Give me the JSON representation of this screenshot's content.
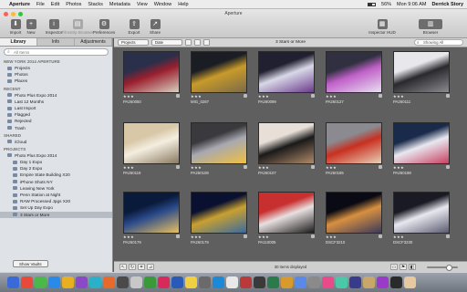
{
  "menubar": {
    "apple": "",
    "app": "Aperture",
    "items": [
      "File",
      "Edit",
      "Photos",
      "Stacks",
      "Metadata",
      "View",
      "Window",
      "Help"
    ],
    "battery": "56%",
    "time": "Mon 9:06 AM",
    "user": "Derrick Story"
  },
  "window": {
    "title": "Aperture"
  },
  "toolbar": {
    "import": "Import",
    "new": "New",
    "inspector": "Inspector",
    "filmstrip": "Filmstrip Browser",
    "preferences": "Preferences",
    "export": "Export",
    "share": "Share",
    "inspector_hud": "Inspector HUD",
    "browser": "Browser"
  },
  "sidebar": {
    "tabs": [
      "Library",
      "Info",
      "Adjustments"
    ],
    "search_placeholder": "All Items",
    "sections": [
      {
        "title": "NEW YORK 2014 APERTURE",
        "items": [
          {
            "label": "Projects",
            "count": ""
          },
          {
            "label": "Photos",
            "count": ""
          },
          {
            "label": "Places",
            "count": ""
          }
        ]
      },
      {
        "title": "RECENT",
        "items": [
          {
            "label": "Photo Plus Expo 2014",
            "count": ""
          },
          {
            "label": "Last 12 Months",
            "count": ""
          },
          {
            "label": "Last Import",
            "count": ""
          },
          {
            "label": "Flagged",
            "count": ""
          },
          {
            "label": "Rejected",
            "count": ""
          },
          {
            "label": "Trash",
            "count": ""
          }
        ]
      },
      {
        "title": "SHARED",
        "items": [
          {
            "label": "iCloud",
            "count": ""
          }
        ]
      },
      {
        "title": "PROJECTS",
        "items": [
          {
            "label": "Photo Plus Expo 2014",
            "count": "",
            "level": 0
          },
          {
            "label": "Day 1 Expo",
            "count": "",
            "level": 1
          },
          {
            "label": "Day 2 Expo",
            "count": "",
            "level": 1
          },
          {
            "label": "Empire State Building X20",
            "count": "",
            "level": 1
          },
          {
            "label": "iPhone Shots NY",
            "count": "",
            "level": 1
          },
          {
            "label": "Leaving New York",
            "count": "",
            "level": 1
          },
          {
            "label": "Penn Station at Night",
            "count": "",
            "level": 1
          },
          {
            "label": "RAW Processed Jpgs X20",
            "count": "",
            "level": 1
          },
          {
            "label": "Set Up Day Expo",
            "count": "",
            "level": 1
          },
          {
            "label": "3 Stars or More",
            "count": "",
            "level": 1,
            "selected": true
          }
        ]
      }
    ],
    "show_vaults": "Show Vaults"
  },
  "filterbar": {
    "mode": "Projects",
    "sort": "Date",
    "album_title": "3 Stars or More",
    "search_placeholder": "Showing All"
  },
  "photos": [
    {
      "caption": "PA260050",
      "stars": "★★★",
      "colors": [
        "#2a2f4a",
        "#9a1f2e",
        "#d8d0c0"
      ]
    },
    {
      "caption": "MIG_0287",
      "stars": "★★★",
      "colors": [
        "#1a1e24",
        "#c89a2a",
        "#7a6a48"
      ]
    },
    {
      "caption": "PA260099",
      "stars": "★★★",
      "colors": [
        "#202030",
        "#d8d8e8",
        "#6a3a8a"
      ]
    },
    {
      "caption": "PA260127",
      "stars": "★★★",
      "colors": [
        "#303040",
        "#c060c8",
        "#e8e0f0"
      ]
    },
    {
      "caption": "PA260111",
      "stars": "★★★",
      "colors": [
        "#e8e8ec",
        "#2a2a2e",
        "#8a8a90"
      ]
    },
    {
      "caption": "PA260119",
      "stars": "★★★",
      "colors": [
        "#d8c8a8",
        "#f4eee0",
        "#8a7a60"
      ]
    },
    {
      "caption": "PA260108",
      "stars": "★★★",
      "colors": [
        "#3a3a3e",
        "#a8a8b0",
        "#f0c040"
      ]
    },
    {
      "caption": "PA260107",
      "stars": "★★★",
      "colors": [
        "#e8e0d8",
        "#1a1a1a",
        "#b08a6a"
      ]
    },
    {
      "caption": "PA260185",
      "stars": "★★★",
      "colors": [
        "#8a8a90",
        "#c83020",
        "#e8d0b8"
      ]
    },
    {
      "caption": "PA260198",
      "stars": "★★★",
      "colors": [
        "#1a2a4a",
        "#e8e8f0",
        "#c84060"
      ]
    },
    {
      "caption": "PA260179",
      "stars": "★★★",
      "colors": [
        "#0a1a3a",
        "#2a4a8a",
        "#e8c060"
      ]
    },
    {
      "caption": "PA260179",
      "stars": "★★★",
      "colors": [
        "#0a1030",
        "#c8a030",
        "#3a6aa0"
      ]
    },
    {
      "caption": "PA110005",
      "stars": "★★★",
      "colors": [
        "#c83030",
        "#e8e0e0",
        "#1a1a1a"
      ]
    },
    {
      "caption": "DSCF3210",
      "stars": "★★★",
      "colors": [
        "#0a0a14",
        "#d89040",
        "#3a3a5a"
      ]
    },
    {
      "caption": "DSCF3230",
      "stars": "★★★",
      "colors": [
        "#1a1a24",
        "#e8e8f0",
        "#5a5a70"
      ]
    }
  ],
  "status": {
    "message": "30 items displayed"
  },
  "dock_colors": [
    "#3a6ad8",
    "#e84a3a",
    "#4ab84a",
    "#2a8ae8",
    "#e8b020",
    "#8a4ac8",
    "#2ab0c8",
    "#e86a2a",
    "#4a4a4a",
    "#c8c8c8",
    "#3a9a3a",
    "#d82a5a",
    "#2a5ab8",
    "#f0d040",
    "#6a6a6a",
    "#1a8ad8",
    "#e8e8e8",
    "#b83a3a",
    "#3a3a3a",
    "#2a7a4a",
    "#d89a2a",
    "#5a8ae8",
    "#8a8a8a",
    "#e84a8a",
    "#4ac8a8",
    "#3a3a8a",
    "#c8a86a",
    "#9a3ac8",
    "#2a2a2a",
    "#e8c8a0"
  ]
}
